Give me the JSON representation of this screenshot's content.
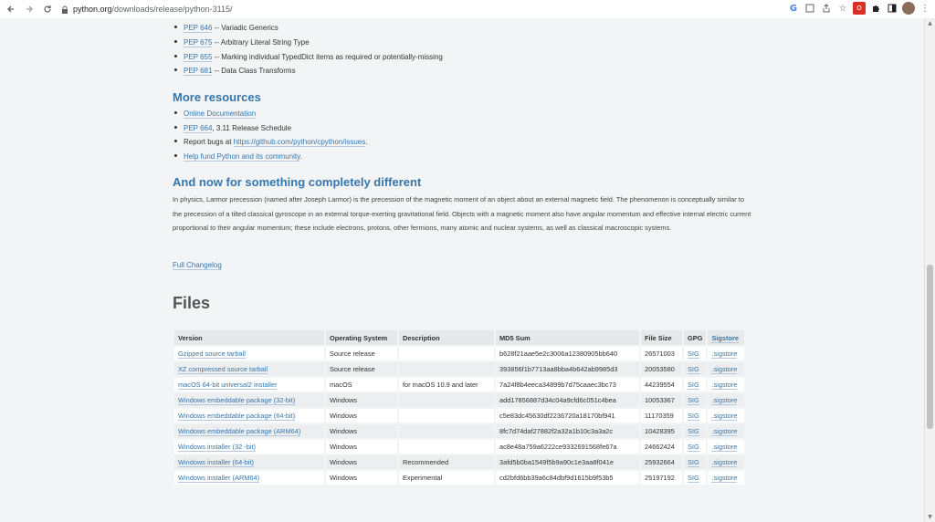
{
  "browser": {
    "url_host": "python.org",
    "url_path": "/downloads/release/python-3115/"
  },
  "peps": [
    {
      "link": "PEP 646",
      "text": " -- Variadic Generics"
    },
    {
      "link": "PEP 675",
      "text": " -- Arbitrary Literal String Type"
    },
    {
      "link": "PEP 655",
      "text": " -- Marking individual TypedDict items as required or potentially-missing"
    },
    {
      "link": "PEP 681",
      "text": " -- Data Class Transforms"
    }
  ],
  "more_resources": {
    "heading": "More resources",
    "online_docs": "Online Documentation",
    "pep664_link": "PEP 664",
    "pep664_text": ", 3.11 Release Schedule",
    "report_prefix": "Report bugs at ",
    "report_link": "https://github.com/python/cpython/issues",
    "report_suffix": ".",
    "help_fund": "Help fund Python and its community",
    "help_fund_suffix": "."
  },
  "different": {
    "heading": "And now for something completely different",
    "paragraph": "In physics, Larmor precession (named after Joseph Larmor) is the precession of the magnetic moment of an object about an external magnetic field. The phenomenon is conceptually similar to the precession of a tilted classical gyroscope in an external torque-exerting gravitational field. Objects with a magnetic moment also have angular momentum and effective internal electric current proportional to their angular momentum; these include electrons, protons, other fermions, many atomic and nuclear systems, as well as classical macroscopic systems.",
    "changelog": "Full Changelog"
  },
  "files": {
    "heading": "Files",
    "headers": {
      "version": "Version",
      "os": "Operating System",
      "description": "Description",
      "md5": "MD5 Sum",
      "size": "File Size",
      "gpg": "GPG",
      "sigstore": "Sigstore"
    },
    "rows": [
      {
        "version": "Gzipped source tarball",
        "os": "Source release",
        "description": "",
        "md5": "b628f21aae5e2c3006a12380905bb640",
        "size": "26571003",
        "gpg": "SIG",
        "sigstore": ".sigstore"
      },
      {
        "version": "XZ compressed source tarball",
        "os": "Source release",
        "description": "",
        "md5": "393856f1b7713aa8bba4b642ab9985d3",
        "size": "20053580",
        "gpg": "SIG",
        "sigstore": ".sigstore"
      },
      {
        "version": "macOS 64-bit universal2 installer",
        "os": "macOS",
        "description": "for macOS 10.9 and later",
        "md5": "7a24f8b4eeca34899b7d75caaec3bc73",
        "size": "44239554",
        "gpg": "SIG",
        "sigstore": ".sigstore"
      },
      {
        "version": "Windows embeddable package (32-bit)",
        "os": "Windows",
        "description": "",
        "md5": "add17856887d34c04a9cfd6c051c4bea",
        "size": "10053367",
        "gpg": "SIG",
        "sigstore": ".sigstore"
      },
      {
        "version": "Windows embeddable package (64-bit)",
        "os": "Windows",
        "description": "",
        "md5": "c5e83dc45630df2236720a18170bf941",
        "size": "11170359",
        "gpg": "SIG",
        "sigstore": ".sigstore"
      },
      {
        "version": "Windows embeddable package (ARM64)",
        "os": "Windows",
        "description": "",
        "md5": "8fc7d74daf27882f2a32a1b10c3a3a2c",
        "size": "10428395",
        "gpg": "SIG",
        "sigstore": ".sigstore"
      },
      {
        "version": "Windows installer (32 -bit)",
        "os": "Windows",
        "description": "",
        "md5": "ac8e48a759a6222ce9332691568fe67a",
        "size": "24662424",
        "gpg": "SIG",
        "sigstore": ".sigstore"
      },
      {
        "version": "Windows installer (64-bit)",
        "os": "Windows",
        "description": "Recommended",
        "md5": "3afd5b0ba1549f5b9a90c1e3aa8f041e",
        "size": "25932664",
        "gpg": "SIG",
        "sigstore": ".sigstore"
      },
      {
        "version": "Windows installer (ARM64)",
        "os": "Windows",
        "description": "Experimental",
        "md5": "cd2bfd6bb39a6c84dbf9d1615b9f53b5",
        "size": "25197192",
        "gpg": "SIG",
        "sigstore": ".sigstore"
      }
    ]
  },
  "colors": {
    "link": "#3776ab",
    "heading": "#3776ab",
    "background": "#f2f4f6"
  }
}
